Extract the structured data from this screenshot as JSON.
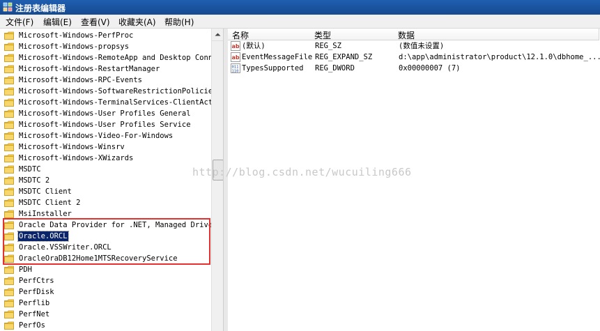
{
  "window": {
    "title": "注册表编辑器"
  },
  "menu": [
    {
      "label": "文件(F)"
    },
    {
      "label": "编辑(E)"
    },
    {
      "label": "查看(V)"
    },
    {
      "label": "收藏夹(A)"
    },
    {
      "label": "帮助(H)"
    }
  ],
  "tree": {
    "selected": "Oracle.ORCL",
    "items": [
      {
        "label": "Microsoft-Windows-PerfProc"
      },
      {
        "label": "Microsoft-Windows-propsys"
      },
      {
        "label": "Microsoft-Windows-RemoteApp and Desktop Connec"
      },
      {
        "label": "Microsoft-Windows-RestartManager"
      },
      {
        "label": "Microsoft-Windows-RPC-Events"
      },
      {
        "label": "Microsoft-Windows-SoftwareRestrictionPolicies"
      },
      {
        "label": "Microsoft-Windows-TerminalServices-ClientActiv"
      },
      {
        "label": "Microsoft-Windows-User Profiles General"
      },
      {
        "label": "Microsoft-Windows-User Profiles Service"
      },
      {
        "label": "Microsoft-Windows-Video-For-Windows"
      },
      {
        "label": "Microsoft-Windows-Winsrv"
      },
      {
        "label": "Microsoft-Windows-XWizards"
      },
      {
        "label": "MSDTC"
      },
      {
        "label": "MSDTC 2"
      },
      {
        "label": "MSDTC Client"
      },
      {
        "label": "MSDTC Client 2"
      },
      {
        "label": "MsiInstaller"
      },
      {
        "label": "Oracle Data Provider for .NET, Managed Driver"
      },
      {
        "label": "Oracle.ORCL"
      },
      {
        "label": "Oracle.VSSWriter.ORCL"
      },
      {
        "label": "OracleOraDB12Home1MTSRecoveryService"
      },
      {
        "label": "PDH"
      },
      {
        "label": "PerfCtrs"
      },
      {
        "label": "PerfDisk"
      },
      {
        "label": "Perflib"
      },
      {
        "label": "PerfNet"
      },
      {
        "label": "PerfOs"
      }
    ]
  },
  "values": {
    "columns": [
      "名称",
      "类型",
      "数据"
    ],
    "rows": [
      {
        "icon": "string-value-icon",
        "name": "(默认)",
        "type": "REG_SZ",
        "data": "(数值未设置)"
      },
      {
        "icon": "string-value-icon",
        "name": "EventMessageFile",
        "type": "REG_EXPAND_SZ",
        "data": "d:\\app\\administrator\\product\\12.1.0\\dbhome_..."
      },
      {
        "icon": "binary-value-icon",
        "name": "TypesSupported",
        "type": "REG_DWORD",
        "data": "0x00000007 (7)"
      }
    ]
  },
  "watermark": "http://blog.csdn.net/wucuiling666",
  "colors": {
    "titlebar": "#1f5fb0",
    "highlight_box": "#e63030",
    "selection": "#0a246a"
  }
}
